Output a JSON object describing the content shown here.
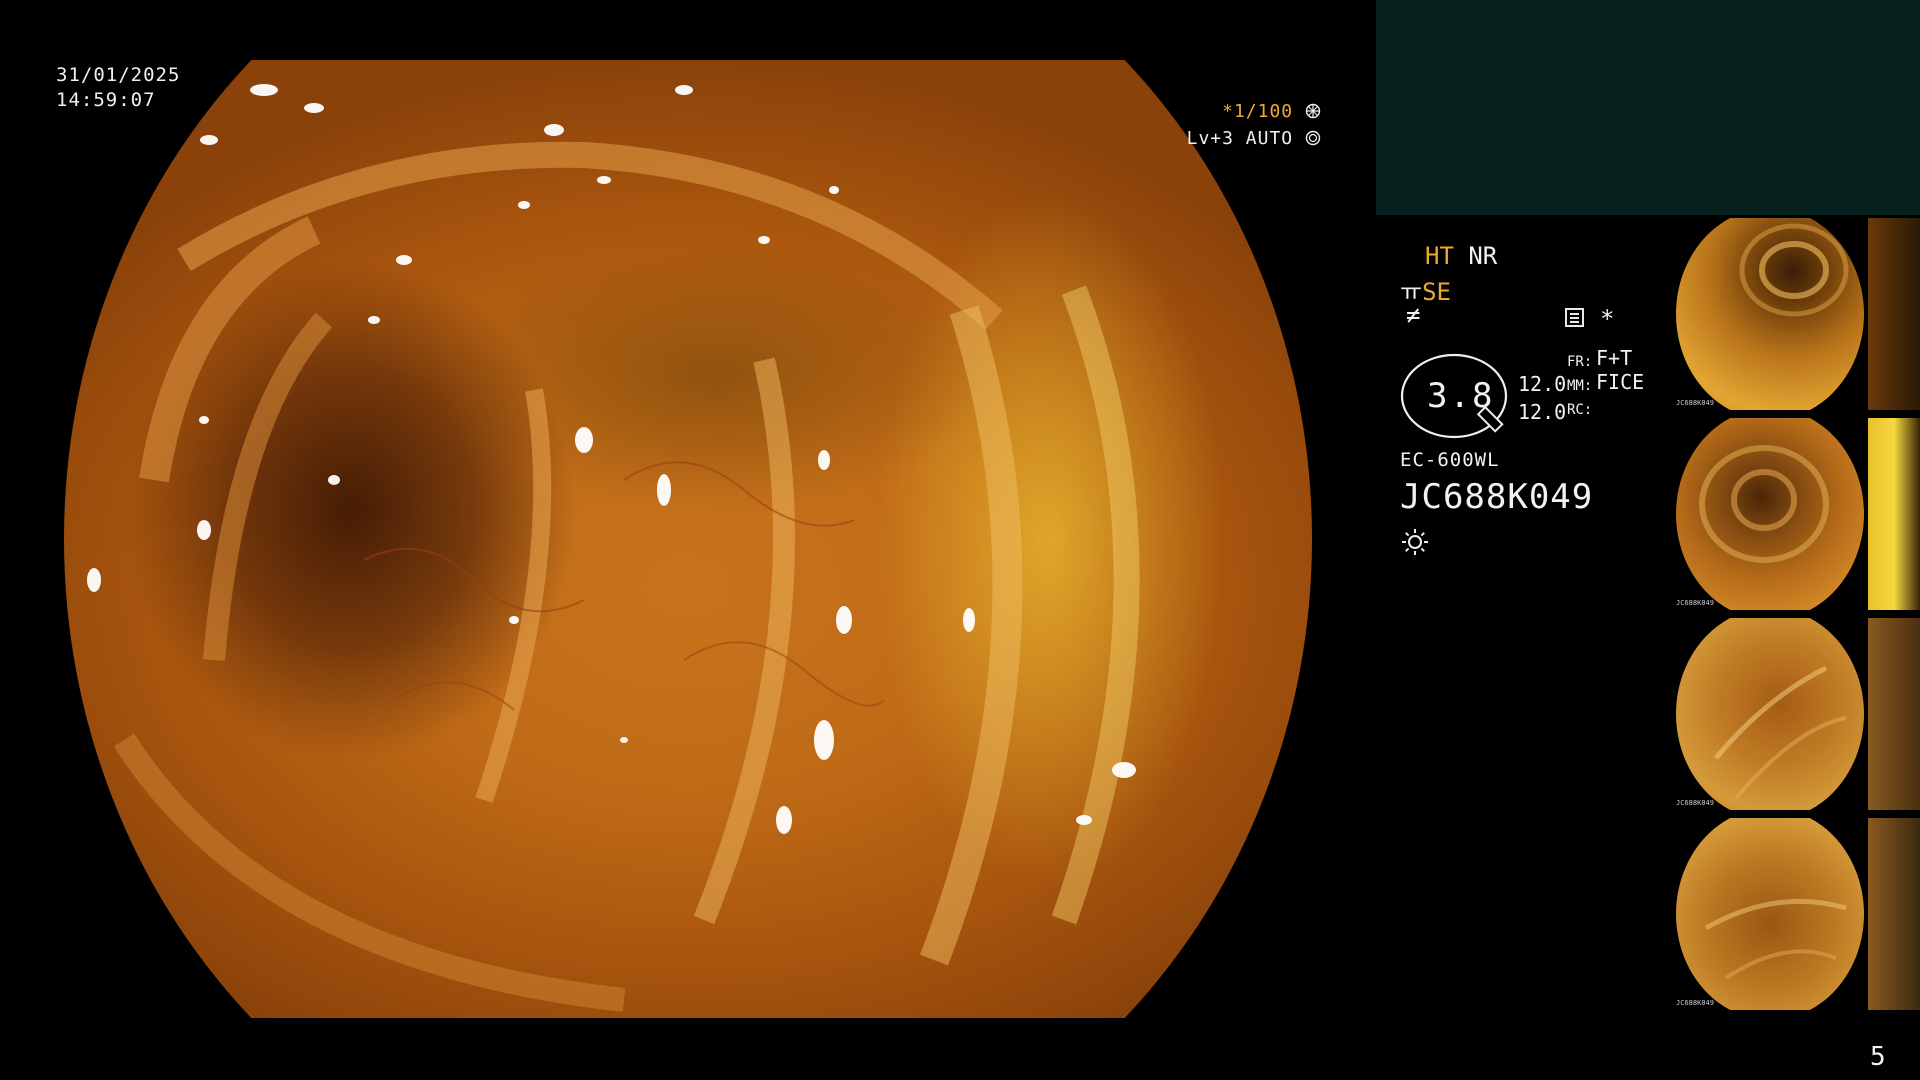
{
  "overlay": {
    "date": "31/01/2025",
    "time": "14:59:07",
    "shutter": "*1/100",
    "level": "Lv+3 AUTO"
  },
  "info": {
    "ht": "HT",
    "nr": "NR",
    "se_prefix": "ㅠ",
    "se": "SE",
    "f_icon": "≠",
    "star": "*",
    "zoom": "3.8",
    "num1": "12.0",
    "num2": "12.0",
    "fr_label": "FR:",
    "mm_label": "MM:",
    "rc_label": "RC:",
    "fr_value": "F+T",
    "mm_value": "FICE",
    "model": "EC-600WL",
    "serial": "JC688K049"
  },
  "thumbnails": [
    {
      "caption": "JC688K049"
    },
    {
      "caption": "JC688K049"
    },
    {
      "caption": "JC688K049"
    },
    {
      "caption": "JC688K049"
    }
  ],
  "page_number": "5",
  "colors": {
    "background": "#000000",
    "accent_yellow": "#f0a833",
    "panel_dark": "#06201d"
  },
  "icons": [
    "aperture-icon",
    "auto-iris-icon",
    "image-mode-icon",
    "brightness-icon",
    "zoom-indicator-icon"
  ]
}
